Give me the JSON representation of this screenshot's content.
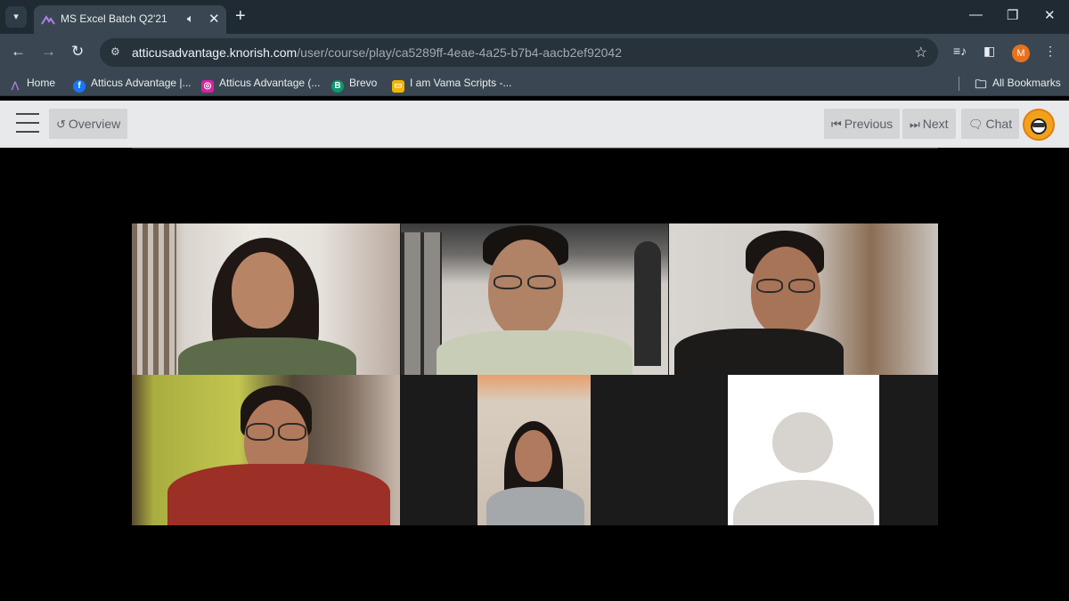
{
  "browser": {
    "tab_title": "MS Excel Batch Q2'21",
    "url_host": "atticusadvantage.knorish.com",
    "url_path": "/user/course/play/ca5289ff-4eae-4a25-b7b4-aacb2ef92042",
    "profile_initial": "M",
    "bookmarks": [
      {
        "label": "Home",
        "icon": "knorish-icon"
      },
      {
        "label": "Atticus Advantage |...",
        "icon": "facebook-icon"
      },
      {
        "label": "Atticus Advantage (...",
        "icon": "instagram-icon"
      },
      {
        "label": "Brevo",
        "icon": "brevo-icon"
      },
      {
        "label": "I am Vama Scripts -...",
        "icon": "slides-icon"
      }
    ],
    "all_bookmarks": "All Bookmarks"
  },
  "app": {
    "overview_label": "Overview",
    "previous_label": "Previous",
    "next_label": "Next",
    "chat_label": "Chat"
  },
  "colors": {
    "tab_active": "#3a4752",
    "tab_strip": "#1f2a33",
    "appbar": "#e8e9ea",
    "button": "#d2d4d6",
    "profile": "#e8711f"
  }
}
